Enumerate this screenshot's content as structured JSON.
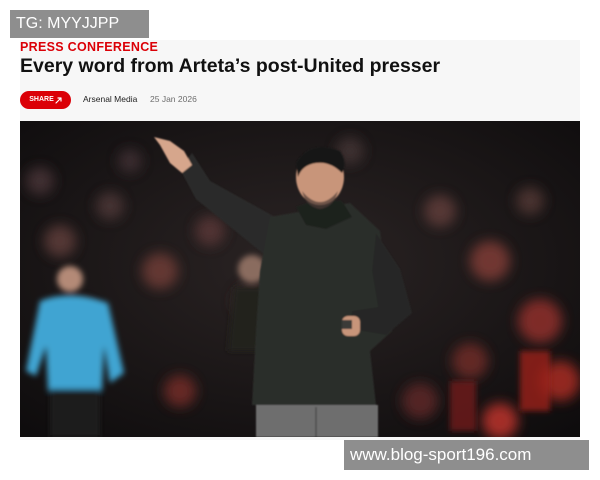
{
  "watermarks": {
    "top": "TG: MYYJJPP",
    "bottom": "www.blog-sport196.com"
  },
  "article": {
    "kicker": "PRESS CONFERENCE",
    "headline": "Every word from Arteta’s post-United presser",
    "share_label": "SHARE",
    "share_icon": "share-arrow-icon",
    "publisher": "Arsenal Media",
    "date": "25 Jan 2026"
  },
  "colors": {
    "accent": "#db0007",
    "watermark_bg": "#8e8e8e",
    "card_bg": "#f7f7f7"
  }
}
